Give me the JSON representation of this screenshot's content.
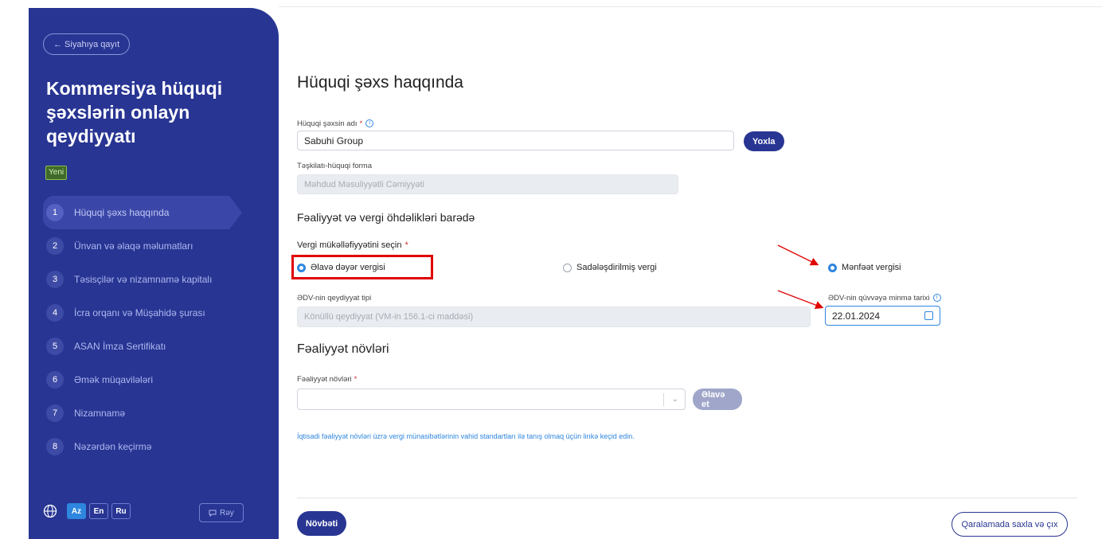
{
  "sidebar": {
    "back_label": "← Siyahıya qayıt",
    "title": "Kommersiya hüquqi şəxslərin onlayn qeydiyyatı",
    "badge": "Yeni",
    "steps": [
      {
        "num": "1",
        "label": "Hüquqi şəxs haqqında"
      },
      {
        "num": "2",
        "label": "Ünvan və əlaqə məlumatları"
      },
      {
        "num": "3",
        "label": "Təsisçilər və nizamnamə kapitalı"
      },
      {
        "num": "4",
        "label": "İcra orqanı və Müşahidə şurası"
      },
      {
        "num": "5",
        "label": "ASAN İmza Sertifikatı"
      },
      {
        "num": "6",
        "label": "Əmək müqavilələri"
      },
      {
        "num": "7",
        "label": "Nizamnamə"
      },
      {
        "num": "8",
        "label": "Nəzərdən keçirmə"
      }
    ],
    "langs": [
      "Az",
      "En",
      "Ru"
    ],
    "feedback_label": "Rəy"
  },
  "main": {
    "title": "Hüquqi şəxs haqqında",
    "name_label": "Hüquqi şəxsin adı",
    "name_value": "Sabuhi Group",
    "check_button": "Yoxla",
    "org_form_label": "Təşkilatı-hüquqi forma",
    "org_form_value": "Məhdud Məsuliyyətli Cəmiyyəti",
    "section_tax": "Fəaliyyət və vergi öhdəlikləri barədə",
    "tax_select_label": "Vergi mükəlləfiyyətini seçin",
    "tax_options": [
      "Əlavə dəyər vergisi",
      "Sadələşdirilmiş vergi",
      "Mənfəət vergisi"
    ],
    "vat_type_label": "ƏDV-nin qeydiyyat tipi",
    "vat_type_value": "Könüllü qeydiyyat (VM-in 156.1-ci maddəsi)",
    "vat_date_label": "ƏDV-nin qüvvəyə minmə tarixi",
    "vat_date_value": "22.01.2024",
    "section_activity": "Fəaliyyət növləri",
    "activity_label": "Fəaliyyət növləri",
    "add_button": "Əlavə et",
    "info_link": "İqtisadi fəaliyyət növləri üzrə vergi münasibətlərinin vahid standartları ilə tanış olmaq üçün linkə keçid edin.",
    "next_button": "Növbəti",
    "save_exit_button": "Qaralamada saxla və çıx"
  },
  "colors": {
    "sidebar": "#283593",
    "accent": "#2e86de",
    "annotation": "#e00000"
  }
}
